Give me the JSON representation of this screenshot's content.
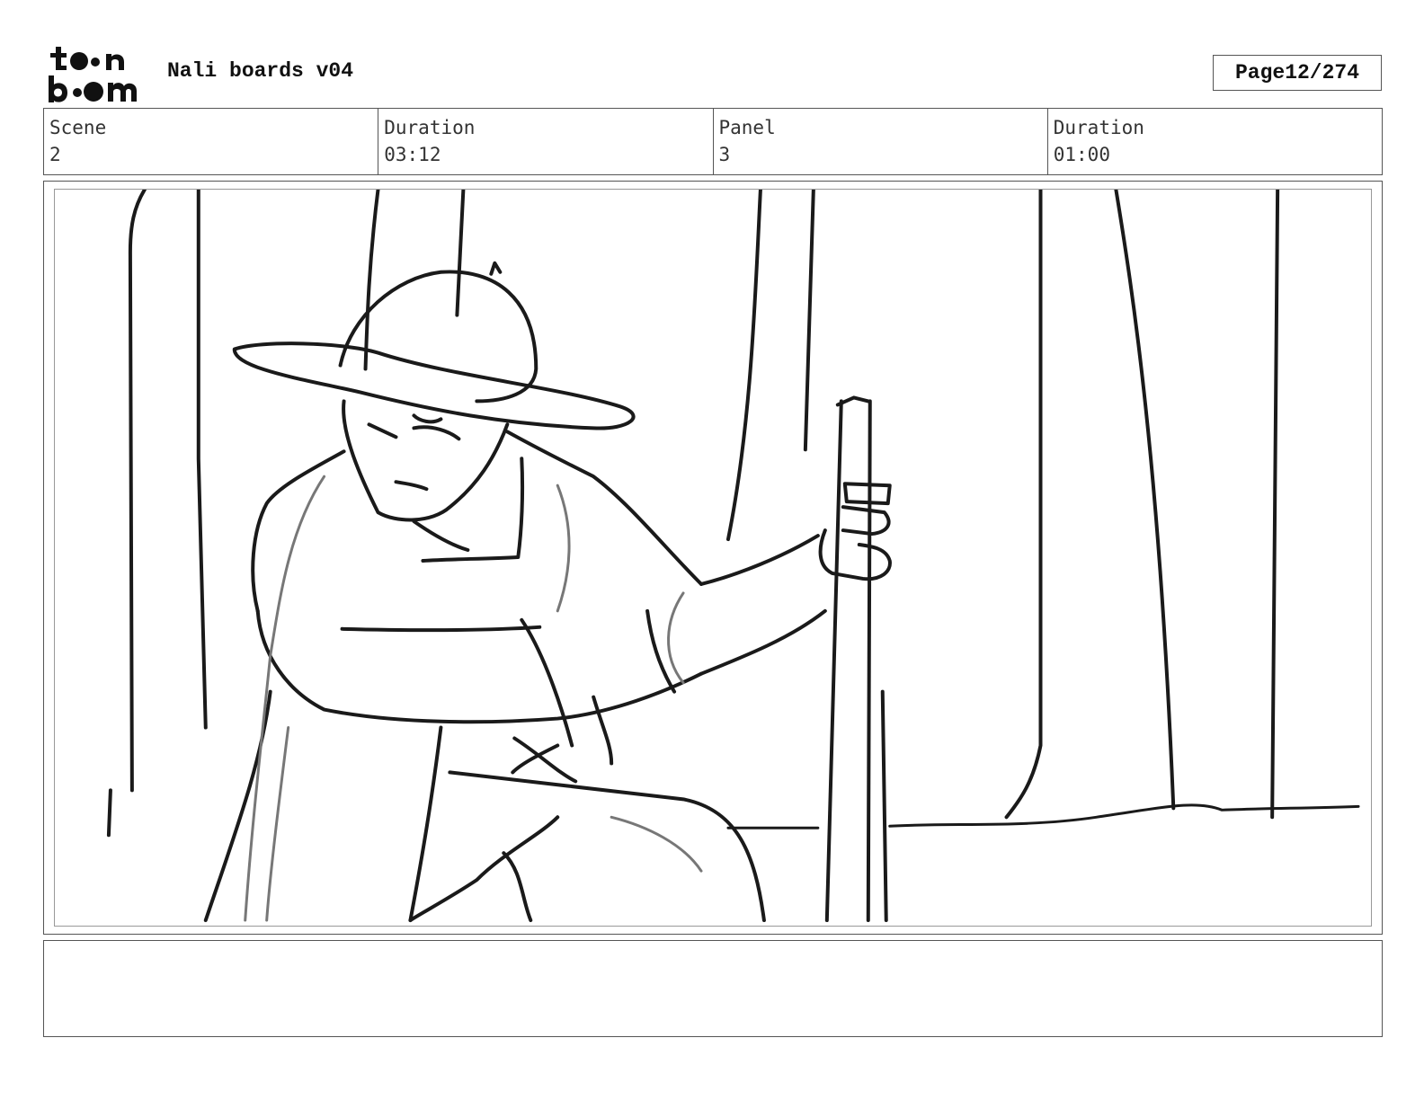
{
  "header": {
    "logo_text": "toon boom",
    "project_title": "Nali boards v04",
    "page_label": "Page",
    "page_number": "12/274"
  },
  "info": {
    "scene_label": "Scene",
    "scene_value": "2",
    "scene_duration_label": "Duration",
    "scene_duration_value": "03:12",
    "panel_label": "Panel",
    "panel_value": "3",
    "panel_duration_label": "Duration",
    "panel_duration_value": "01:00"
  },
  "notes": {
    "text": ""
  }
}
